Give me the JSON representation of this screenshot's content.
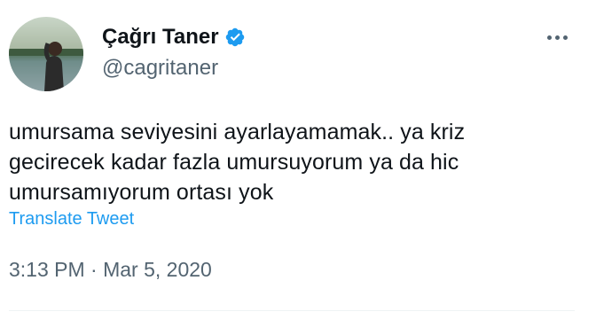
{
  "tweet": {
    "author": {
      "display_name": "Çağrı Taner",
      "handle": "@cagritaner",
      "verified": true,
      "verified_color": "#1d9bf0"
    },
    "more_icon": "ellipsis-horizontal-icon",
    "text_lines": [
      "umursama seviyesini ayarlayamamak.. ya kriz",
      "gecirecek kadar fazla umursuyorum ya da hic",
      "umursamıyorum ortası yok"
    ],
    "translate_label": "Translate Tweet",
    "time": "3:13 PM",
    "separator": "·",
    "date": "Mar 5, 2020"
  },
  "colors": {
    "text": "#0f1419",
    "secondary": "#536471",
    "link": "#1d9bf0",
    "divider": "#eff3f4"
  }
}
